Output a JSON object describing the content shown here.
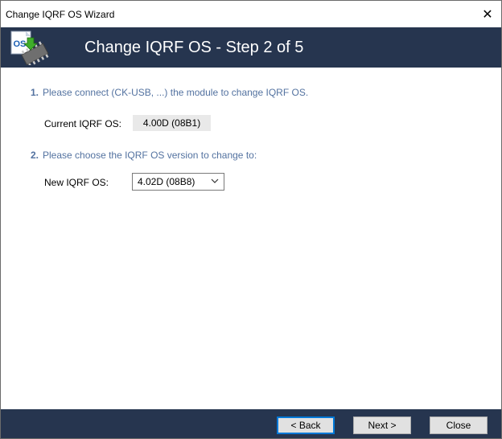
{
  "window": {
    "title": "Change IQRF OS Wizard",
    "close_glyph": "✕"
  },
  "banner": {
    "title": "Change IQRF OS - Step 2 of 5",
    "logo_text": "OS",
    "logo_icon": "os-chip-icon",
    "background": "#26354f"
  },
  "steps": [
    {
      "number": "1.",
      "text": "Please connect (CK-USB, ...) the module to change IQRF OS."
    },
    {
      "number": "2.",
      "text": "Please choose the IQRF OS version to change to:"
    }
  ],
  "current_os": {
    "label": "Current IQRF OS:",
    "value": "4.00D (08B1)"
  },
  "new_os": {
    "label": "New IQRF OS:",
    "selected": "4.02D (08B8)"
  },
  "footer": {
    "back_label": "< Back",
    "next_label": "Next >",
    "close_label": "Close"
  },
  "colors": {
    "step_text": "#5372a0",
    "accent_focus": "#0078d7"
  }
}
